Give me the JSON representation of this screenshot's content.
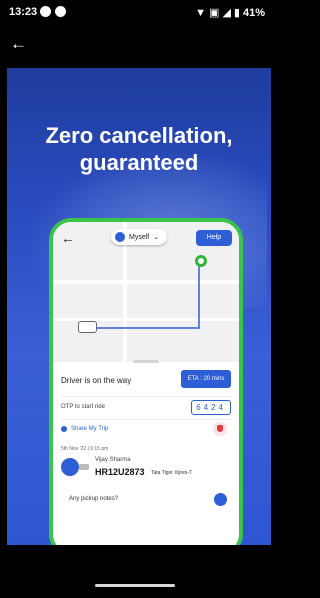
{
  "status_bar": {
    "time": "13:23",
    "battery": "41%",
    "icons": [
      "play-icon",
      "circle-icon",
      "wifi-icon",
      "hd-icon",
      "signal-icon",
      "r-icon",
      "battery-icon"
    ]
  },
  "topbar": {
    "back_icon": "←"
  },
  "promo": {
    "headline_line1": "Zero cancellation,",
    "headline_line2": "guaranteed"
  },
  "phone": {
    "map_back": "←",
    "rider_selector": "Myself",
    "rider_chevron": "⌄",
    "help_label": "Help",
    "driver_status": "Driver is on the way",
    "eta_label": "ETA : 20 mins",
    "otp_label": "OTP to start ride",
    "otp_value": "6424",
    "share_label": "Share My Trip",
    "date_time": "5th Nov '22 | 6:15 pm",
    "driver_name": "Vijay Sharma",
    "plate": "HR12U2873",
    "car_model": "Tata Tigor Xpres-T",
    "pickup_notes": "Any pickup notes?"
  },
  "colors": {
    "accent": "#2d5ed6",
    "frame_green": "#3bc44a",
    "promo_bg": "#2b4bc0"
  }
}
